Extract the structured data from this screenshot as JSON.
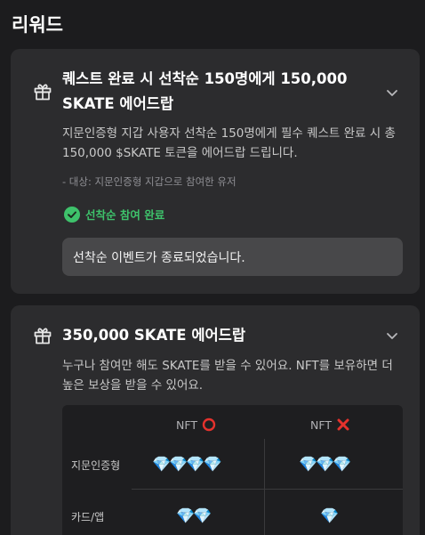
{
  "page": {
    "title": "리워드"
  },
  "card1": {
    "title": "퀘스트 완료 시 선착순 150명에게 150,000 SKATE 에어드랍",
    "description": "지문인증형 지갑 사용자 선착순 150명에게 필수 퀘스트 완료 시 총 150,000 $SKATE 토큰을 에어드랍 드립니다.",
    "note": "- 대상: 지문인증형 지갑으로 참여한 유저",
    "status": "선착순 참여 완료",
    "notice": "선착순 이벤트가 종료되었습니다."
  },
  "card2": {
    "title": "350,000 SKATE 에어드랍",
    "description": "누구나 참여만 해도 SKATE를 받을 수 있어요. NFT를 보유하면 더 높은 보상을 받을 수 있어요.",
    "table": {
      "col_with_nft": "NFT",
      "col_without_nft": "NFT",
      "rows": [
        {
          "label": "지문인증형",
          "with_nft": "💎💎💎💎",
          "without_nft": "💎💎💎"
        },
        {
          "label": "카드/앱",
          "with_nft": "💎💎",
          "without_nft": "💎"
        }
      ]
    }
  },
  "colors": {
    "background": "#1c1c1e",
    "card": "#2c2c2e",
    "success": "#3ec26b",
    "accent_red": "#e5322d"
  }
}
